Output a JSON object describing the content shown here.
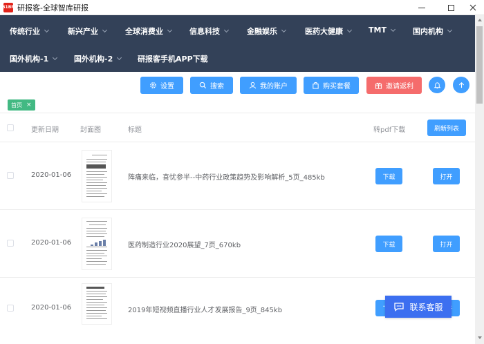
{
  "window": {
    "logo_text": "51BP",
    "title": "研报客-全球智库研报"
  },
  "nav": {
    "items": [
      {
        "label": "传统行业",
        "has_dropdown": true
      },
      {
        "label": "新兴产业",
        "has_dropdown": true
      },
      {
        "label": "全球消费业",
        "has_dropdown": true
      },
      {
        "label": "信息科技",
        "has_dropdown": true
      },
      {
        "label": "金融娱乐",
        "has_dropdown": true
      },
      {
        "label": "医药大健康",
        "has_dropdown": true
      },
      {
        "label": "TMT",
        "has_dropdown": true
      },
      {
        "label": "国内机构",
        "has_dropdown": true
      },
      {
        "label": "国外机构-1",
        "has_dropdown": true
      },
      {
        "label": "国外机构-2",
        "has_dropdown": true
      },
      {
        "label": "研报客手机APP下载",
        "has_dropdown": false
      }
    ]
  },
  "actions": {
    "settings": "设置",
    "search": "搜索",
    "account": "我的账户",
    "buy": "购买套餐",
    "invite": "邀请返利"
  },
  "tabs": {
    "home": "首页",
    "close": "×"
  },
  "table": {
    "headers": {
      "date": "更新日期",
      "cover": "封面图",
      "title": "标题",
      "pdf": "转pdf下载"
    },
    "refresh_label": "刷新列表",
    "download_label": "下载",
    "open_label": "打开",
    "rows": [
      {
        "date": "2020-01-06",
        "title": "阵痛来临，喜忧参半--中药行业政策趋势及影响解析_5页_485kb"
      },
      {
        "date": "2020-01-06",
        "title": "医药制造行业2020展望_7页_670kb"
      },
      {
        "date": "2020-01-06",
        "title": "2019年短视频直播行业人才发展报告_9页_845kb"
      }
    ]
  },
  "support": {
    "label": "联系客服"
  },
  "colors": {
    "nav_bg": "#334158",
    "primary": "#409eff",
    "danger": "#f56c6c",
    "tag": "#42b983",
    "support": "#3c6ff0"
  }
}
